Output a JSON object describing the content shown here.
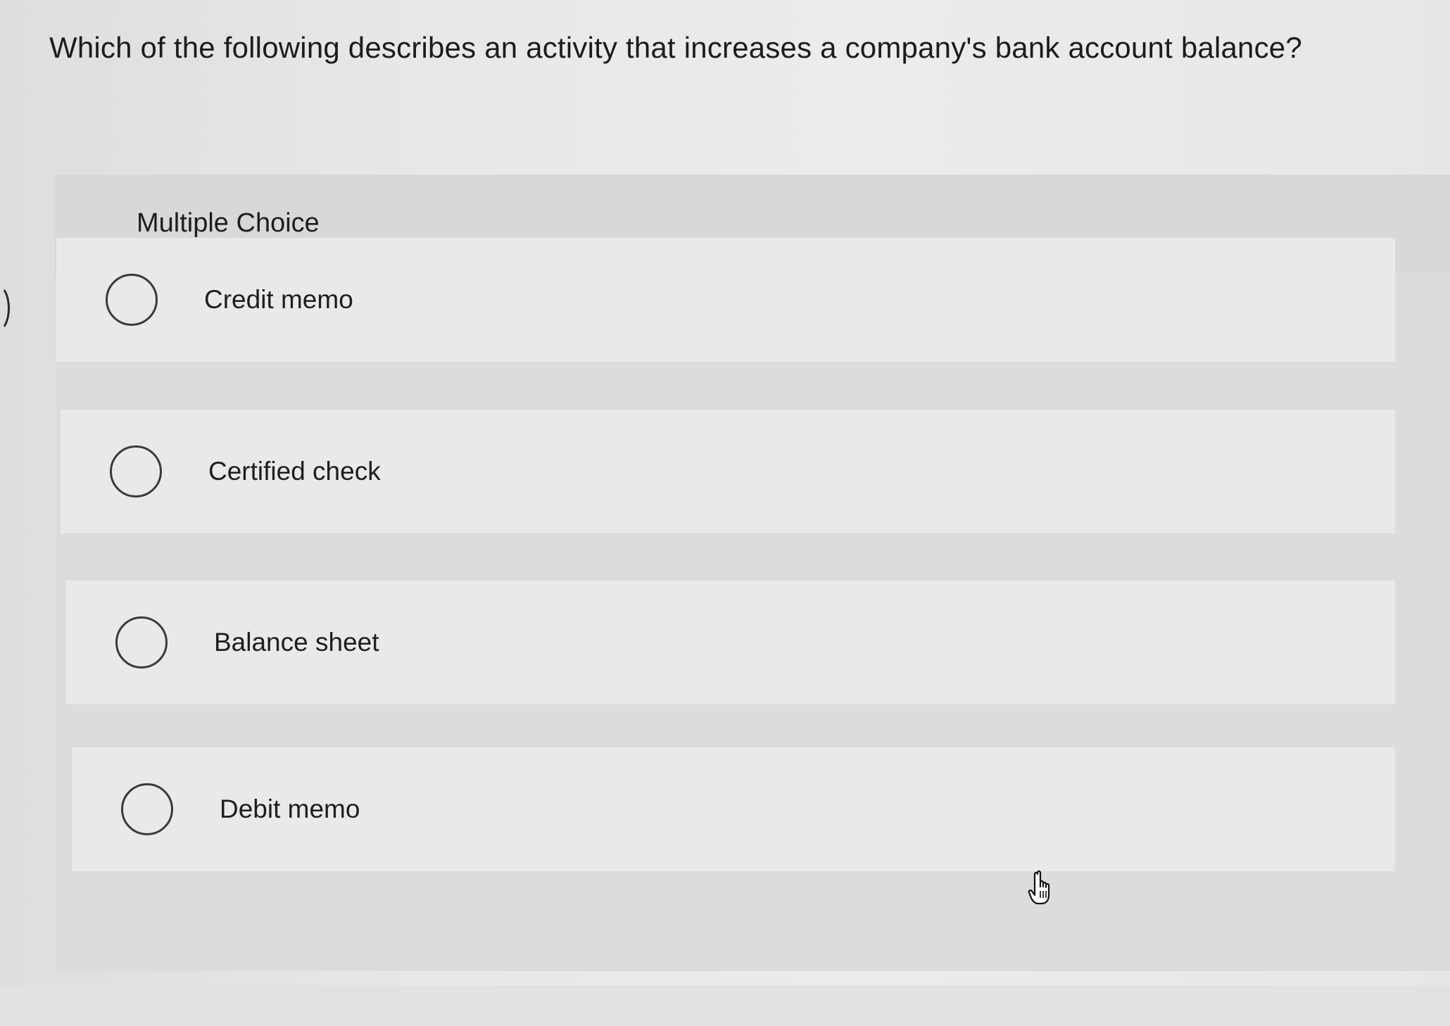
{
  "question": {
    "text": "Which of the following describes an activity that increases a company's bank account balance?"
  },
  "multiple_choice": {
    "label": "Multiple Choice",
    "options": [
      {
        "label": "Credit memo",
        "selected": false
      },
      {
        "label": "Certified check",
        "selected": false
      },
      {
        "label": "Balance sheet",
        "selected": false
      },
      {
        "label": "Debit memo",
        "selected": false
      }
    ]
  },
  "cursor": {
    "icon": "hand-pointer-icon"
  }
}
